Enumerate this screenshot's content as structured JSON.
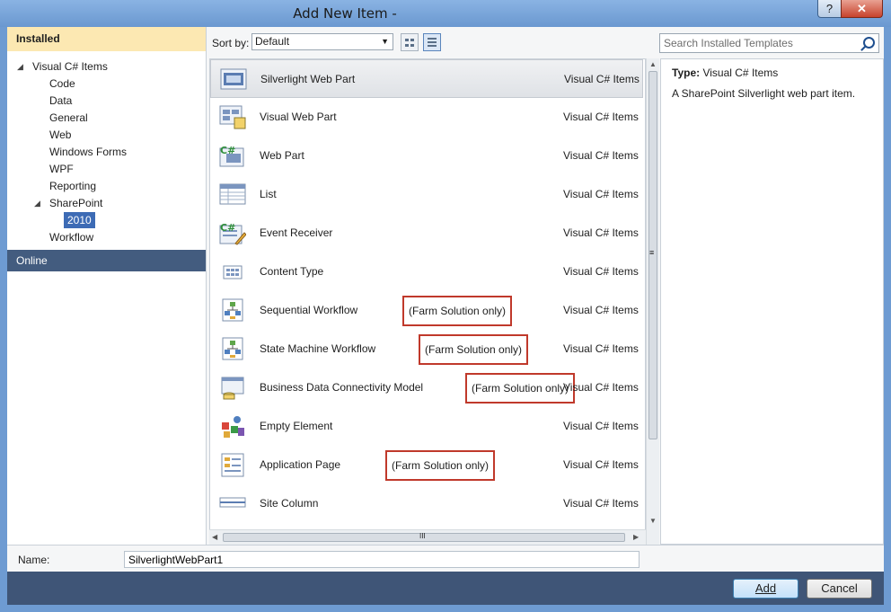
{
  "window": {
    "title": "Add New Item -",
    "help_glyph": "?",
    "close_glyph": "✕"
  },
  "left_panel": {
    "installed_label": "Installed",
    "online_label": "Online",
    "tree": [
      {
        "label": "Visual C# Items",
        "level": 0,
        "arrow": "◢"
      },
      {
        "label": "Code",
        "level": 1
      },
      {
        "label": "Data",
        "level": 1
      },
      {
        "label": "General",
        "level": 1
      },
      {
        "label": "Web",
        "level": 1
      },
      {
        "label": "Windows Forms",
        "level": 1
      },
      {
        "label": "WPF",
        "level": 1
      },
      {
        "label": "Reporting",
        "level": 1
      },
      {
        "label": "SharePoint",
        "level": 1,
        "arrow": "◢"
      },
      {
        "label": "2010",
        "level": 2,
        "selected": true
      },
      {
        "label": "Workflow",
        "level": 1
      }
    ]
  },
  "toolbar": {
    "sort_label": "Sort by:",
    "sort_value": "Default",
    "sort_arrow": "▼",
    "search_placeholder": "Search Installed Templates"
  },
  "templates": [
    {
      "name": "Silverlight Web Part",
      "category": "Visual C# Items",
      "icon": "silverlight-webpart-icon",
      "selected": true
    },
    {
      "name": "Visual Web Part",
      "category": "Visual C# Items",
      "icon": "visual-webpart-icon"
    },
    {
      "name": "Web Part",
      "category": "Visual C# Items",
      "icon": "csharp-webpart-icon"
    },
    {
      "name": "List",
      "category": "Visual C# Items",
      "icon": "list-icon"
    },
    {
      "name": "Event Receiver",
      "category": "Visual C# Items",
      "icon": "event-receiver-icon"
    },
    {
      "name": "Content Type",
      "category": "Visual C# Items",
      "icon": "content-type-icon"
    },
    {
      "name": "Sequential Workflow",
      "note": "(Farm Solution only)",
      "category": "Visual C# Items",
      "icon": "workflow-icon"
    },
    {
      "name": "State Machine Workflow",
      "note": "(Farm Solution only)",
      "category": "Visual C# Items",
      "icon": "workflow-icon"
    },
    {
      "name": "Business Data Connectivity Model",
      "note": "(Farm Solution only)",
      "category": "Visual C# Items",
      "icon": "bdc-model-icon"
    },
    {
      "name": "Empty Element",
      "category": "Visual C# Items",
      "icon": "empty-element-icon"
    },
    {
      "name": "Application Page",
      "note": "(Farm Solution only)",
      "category": "Visual C# Items",
      "icon": "application-page-icon"
    },
    {
      "name": "Site Column",
      "category": "Visual C# Items",
      "icon": "site-column-icon"
    }
  ],
  "details": {
    "type_label": "Type:",
    "type_value": "Visual C# Items",
    "description": "A SharePoint Silverlight web part item."
  },
  "name_field": {
    "label": "Name:",
    "value": "SilverlightWebPart1"
  },
  "buttons": {
    "add_label": "Add",
    "cancel_label": "Cancel"
  },
  "scroll_glyphs": {
    "up": "▲",
    "down": "▼",
    "left": "◀",
    "right": "▶",
    "grip_v": "≡",
    "grip_h": "III"
  },
  "colors": {
    "highlight": "#c0392b",
    "selection": "#3d6bb5",
    "footer": "#3f5577",
    "installed_bg": "#fce8b2"
  }
}
